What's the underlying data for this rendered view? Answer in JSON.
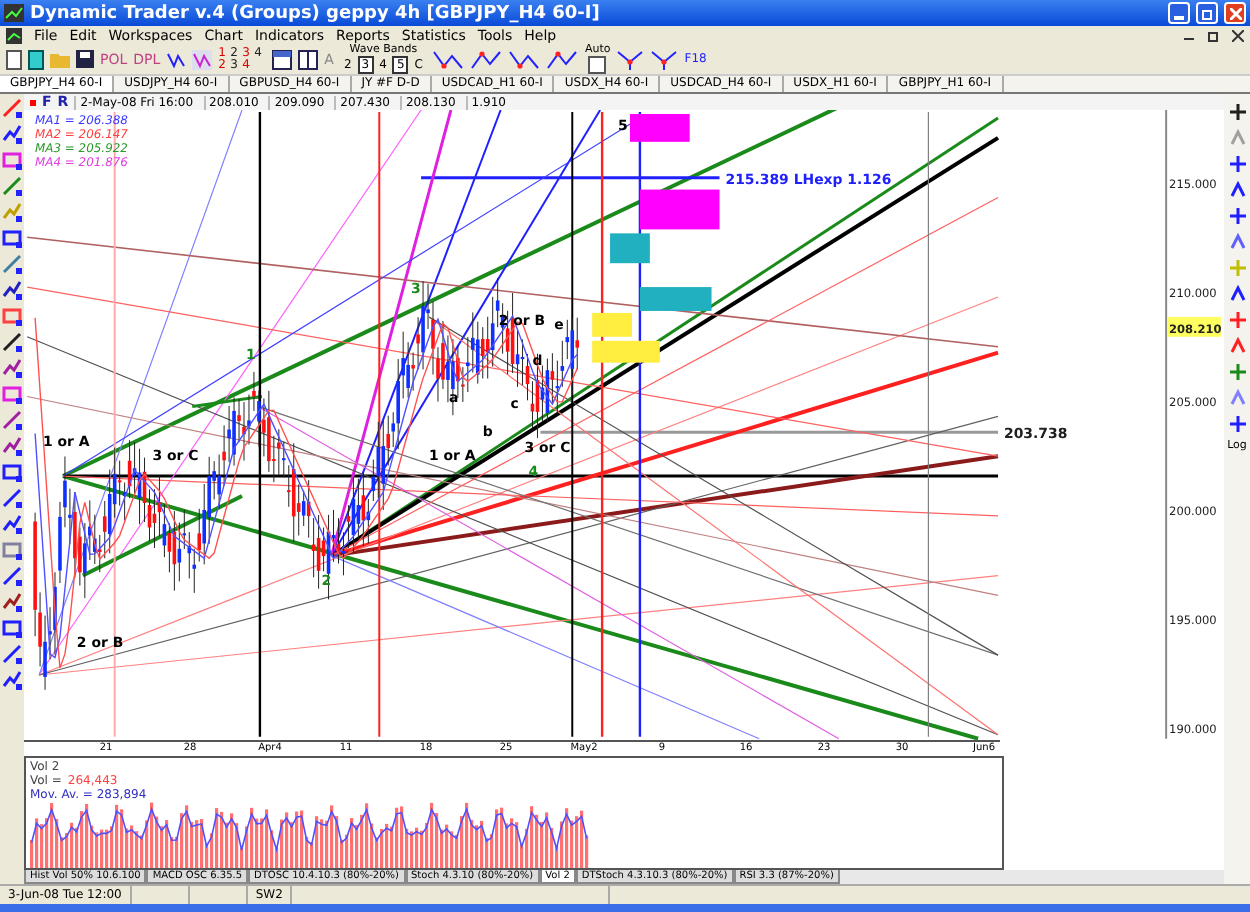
{
  "window": {
    "title": "Dynamic Trader v.4   (Groups)   geppy 4h   [GBPJPY_H4 60-I]"
  },
  "menu": [
    "File",
    "Edit",
    "Workspaces",
    "Chart",
    "Indicators",
    "Reports",
    "Statistics",
    "Tools",
    "Help"
  ],
  "toolbar": {
    "text_buttons": [
      "POL",
      "DPL"
    ],
    "pattern_digits": [
      "1",
      "2",
      "3",
      "4",
      "2",
      "3",
      "4"
    ],
    "letter_button": "A",
    "wave_bands": {
      "label": "Wave Bands",
      "options": [
        {
          "label": "2",
          "selected": false
        },
        {
          "label": "3",
          "selected": true
        },
        {
          "label": "4",
          "selected": false
        },
        {
          "label": "5",
          "selected": true
        },
        {
          "label": "C",
          "selected": false
        }
      ]
    },
    "auto": {
      "label": "Auto",
      "checked": false
    },
    "fib_label": "F18"
  },
  "tabs": [
    {
      "label": "GBPJPY_H4 60-I",
      "selected": true
    },
    {
      "label": "USDJPY_H4 60-I",
      "selected": false
    },
    {
      "label": "GBPUSD_H4 60-I",
      "selected": false
    },
    {
      "label": "JY #F D-D",
      "selected": false
    },
    {
      "label": "USDCAD_H1 60-I",
      "selected": false
    },
    {
      "label": "USDX_H4 60-I",
      "selected": false
    },
    {
      "label": "USDCAD_H4 60-I",
      "selected": false
    },
    {
      "label": "USDX_H1 60-I",
      "selected": false
    },
    {
      "label": "GBPJPY_H1 60-I",
      "selected": false
    }
  ],
  "chart": {
    "header": {
      "flags": [
        "F",
        "R"
      ],
      "date": "2-May-08 Fri 16:00",
      "values": [
        "208.010",
        "209.090",
        "207.430",
        "208.130",
        "1.910"
      ]
    },
    "moving_averages": [
      {
        "label": "MA1 = 206.388",
        "color": "#3a3aff"
      },
      {
        "label": "MA2 = 206.147",
        "color": "#ff4040"
      },
      {
        "label": "MA3 = 205.922",
        "color": "#2a9a2a"
      },
      {
        "label": "MA4 = 201.876",
        "color": "#e040e0"
      }
    ],
    "price_axis": [
      "215.000",
      "210.000",
      "205.000",
      "200.000",
      "195.000",
      "190.000"
    ],
    "last_price": "208.210",
    "annotations": [
      {
        "text": "215.389 LHexp 1.126",
        "color": "#2020ff"
      },
      {
        "text": "203.738",
        "color": "#202020"
      }
    ],
    "wave_labels": [
      {
        "text": "5",
        "color": "#000000"
      },
      {
        "text": "3",
        "color": "#1a8a1a"
      },
      {
        "text": "2 or B",
        "color": "#000000"
      },
      {
        "text": "e",
        "color": "#000000"
      },
      {
        "text": "d",
        "color": "#000000"
      },
      {
        "text": "a",
        "color": "#000000"
      },
      {
        "text": "1",
        "color": "#1a8a1a"
      },
      {
        "text": "c",
        "color": "#000000"
      },
      {
        "text": "b",
        "color": "#000000"
      },
      {
        "text": "1 or A",
        "color": "#000000"
      },
      {
        "text": "3 or C",
        "color": "#000000"
      },
      {
        "text": "3 or C",
        "color": "#000000"
      },
      {
        "text": "1 or A",
        "color": "#000000"
      },
      {
        "text": "4",
        "color": "#1a8a1a"
      },
      {
        "text": "2",
        "color": "#1a8a1a"
      },
      {
        "text": "2 or B",
        "color": "#000000"
      }
    ],
    "date_axis": [
      "21",
      "28",
      "Apr4",
      "11",
      "18",
      "25",
      "May2",
      "9",
      "16",
      "23",
      "30",
      "Jun6"
    ]
  },
  "volume": {
    "title": "Vol 2",
    "vol_label": "Vol =",
    "vol_value": "264,443",
    "mov_avg": "Mov. Av. = 283,894"
  },
  "indicator_tabs": [
    {
      "label": "Hist Vol 50% 10.6.100",
      "selected": false
    },
    {
      "label": "MACD OSC 6.35.5",
      "selected": false
    },
    {
      "label": "DTOSC 10.4.10.3 (80%-20%)",
      "selected": false
    },
    {
      "label": "Stoch 4.3.10 (80%-20%)",
      "selected": false
    },
    {
      "label": "Vol 2",
      "selected": true
    },
    {
      "label": "DTStoch 4.3.10.3 (80%-20%)",
      "selected": false
    },
    {
      "label": "RSI 3.3 (87%-20%)",
      "selected": false
    }
  ],
  "right_toolbar": {
    "log_label": "Log"
  },
  "status_bar": {
    "datetime": "3-Jun-08 Tue 12:00",
    "mode": "SW2"
  }
}
